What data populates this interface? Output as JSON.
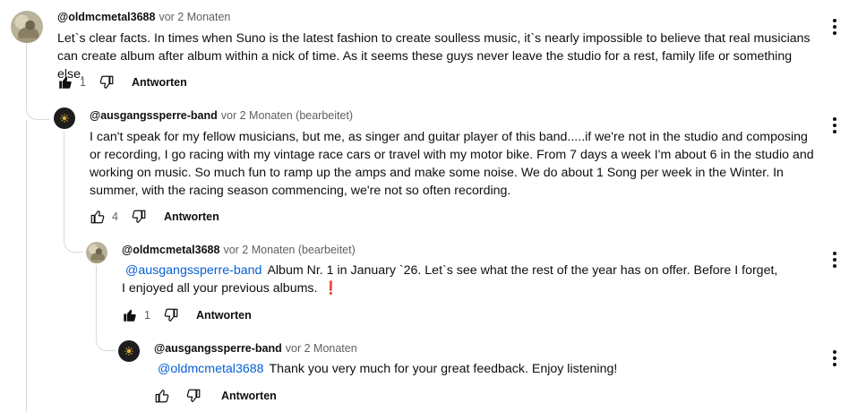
{
  "comments": [
    {
      "author": "@oldmcmetal3688",
      "meta": "vor 2 Monaten",
      "text": "Let`s clear facts. In times when Suno is the latest fashion to create soulless music, it`s nearly impossible to believe that real musicians can create album after album within a nick of time. As it seems these guys never leave the studio for a rest, family life or something else.",
      "likes": "1",
      "reply_label": "Antworten",
      "avatar_icon": "user-photo-avatar"
    },
    {
      "author": "@ausgangssperre-band",
      "meta": "vor 2 Monaten (bearbeitet)",
      "text": "I can't speak for my fellow musicians, but me, as singer and guitar player of this band.....if we're not in the studio and composing or recording, I go racing with my vintage race cars or travel with my motor bike. From 7 days a week I'm about 6 in the studio and working on music. So much fun to ramp up the amps and make some noise. We do about 1 Song per week in the Winter. In summer, with the racing season commencing, we're not so often recording.",
      "likes": "4",
      "reply_label": "Antworten",
      "avatar_icon": "band-logo-avatar"
    },
    {
      "author": "@oldmcmetal3688",
      "meta": "vor 2 Monaten (bearbeitet)",
      "mention": "@ausgangssperre-band",
      "text": "Album Nr. 1 in January `26. Let`s see what the rest of the year has on offer. Before I forget, I enjoyed all your previous albums.",
      "emoji": "❗",
      "likes": "1",
      "reply_label": "Antworten",
      "avatar_icon": "user-photo-avatar"
    },
    {
      "author": "@ausgangssperre-band",
      "meta": "vor 2 Monaten",
      "mention": "@oldmcmetal3688",
      "text": "Thank you very much for your great feedback. Enjoy listening!",
      "likes": "",
      "reply_label": "Antworten",
      "avatar_icon": "band-logo-avatar"
    }
  ],
  "colors": {
    "mention": "#065fd4",
    "meta": "#606060",
    "text": "#0f0f0f",
    "thread_line": "#d9d9d9"
  }
}
